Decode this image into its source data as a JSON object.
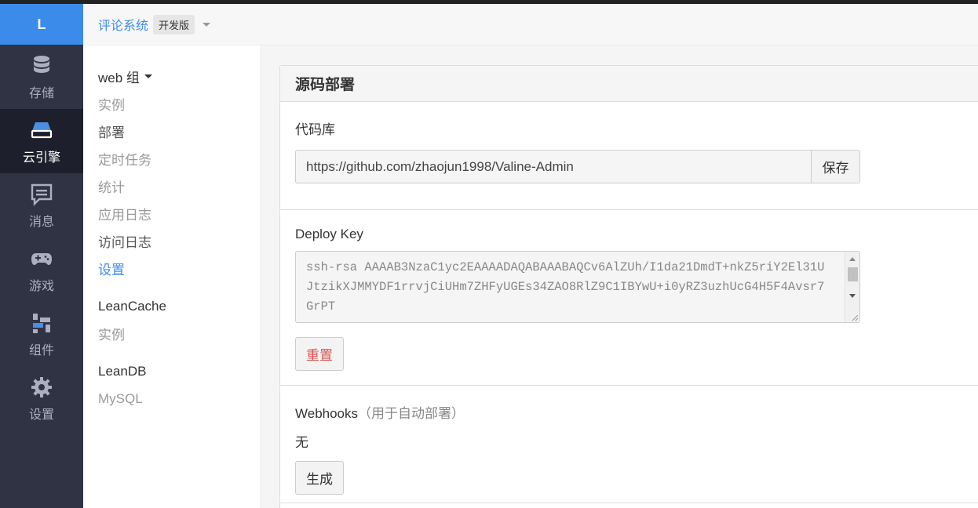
{
  "rail": {
    "logo": "L",
    "items": [
      {
        "label": "存储",
        "icon": "database-icon"
      },
      {
        "label": "云引擎",
        "icon": "server-icon"
      },
      {
        "label": "消息",
        "icon": "message-icon"
      },
      {
        "label": "游戏",
        "icon": "gamepad-icon"
      },
      {
        "label": "组件",
        "icon": "components-icon"
      },
      {
        "label": "设置",
        "icon": "gear-icon"
      }
    ],
    "active_label": "云引擎"
  },
  "header": {
    "app_name": "评论系统",
    "badge": "开发版"
  },
  "subnav": {
    "group1_title": "web 组",
    "group1_items": [
      "实例",
      "部署",
      "定时任务",
      "统计",
      "应用日志",
      "访问日志",
      "设置"
    ],
    "group2_title": "LeanCache",
    "group2_items": [
      "实例"
    ],
    "group3_title": "LeanDB",
    "group3_items": [
      "MySQL"
    ]
  },
  "main": {
    "panel_title": "源码部署",
    "repo_label": "代码库",
    "repo_value": "https://github.com/zhaojun1998/Valine-Admin",
    "save_label": "保存",
    "deploy_key_label": "Deploy Key",
    "deploy_key_value": "ssh-rsa AAAAB3NzaC1yc2EAAAADAQABAAABAQCv6AlZUh/I1da21DmdT+nkZ5riY2El31UJtzikXJMMYDF1rrvjCiUHm7ZHFyUGEs34ZAO8RlZ9C1IBYwU+i0yRZ3uzhUcG4H5F4Avsr7GrPT",
    "reset_label": "重置",
    "webhooks_label": "Webhooks",
    "webhooks_note": "（用于自动部署）",
    "webhooks_value": "无",
    "generate_label": "生成"
  },
  "colors": {
    "rail_bg": "#2f3344",
    "rail_active_bg": "#1d202c",
    "accent": "#3b8beb",
    "danger": "#d9534f"
  }
}
